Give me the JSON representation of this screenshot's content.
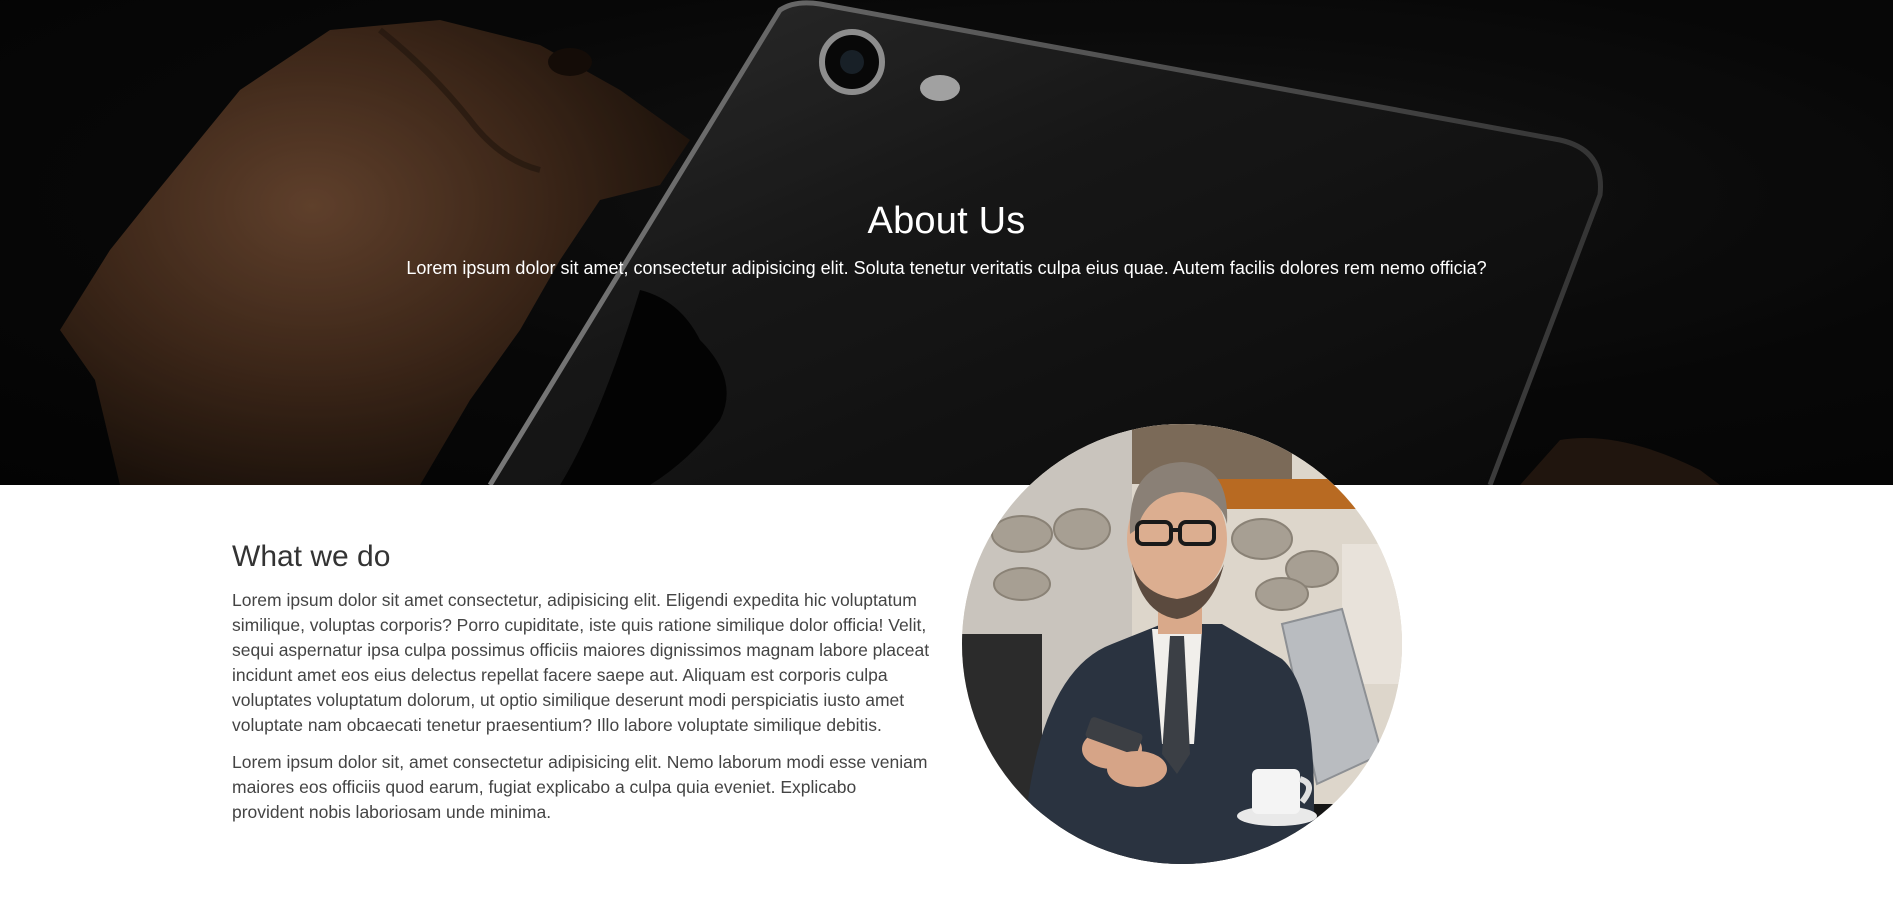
{
  "hero": {
    "title": "About Us",
    "subtitle": "Lorem ipsum dolor sit amet, consectetur adipisicing elit. Soluta tenetur veritatis culpa eius quae. Autem facilis dolores rem nemo officia?"
  },
  "about": {
    "heading": "What we do",
    "paragraphs": [
      "Lorem ipsum dolor sit amet consectetur, adipisicing elit. Eligendi expedita hic voluptatum similique, voluptas corporis? Porro cupiditate, iste quis ratione similique dolor officia! Velit, sequi aspernatur ipsa culpa possimus officiis maiores dignissimos magnam labore placeat incidunt amet eos eius delectus repellat facere saepe aut. Aliquam est corporis culpa voluptates voluptatum dolorum, ut optio similique deserunt modi perspiciatis iusto amet voluptate nam obcaecati tenetur praesentium? Illo labore voluptate similique debitis.",
      "Lorem ipsum dolor sit, amet consectetur adipisicing elit. Nemo laborum modi esse veniam maiores eos officiis quod earum, fugiat explicabo a culpa quia eveniet. Explicabo provident nobis laboriosam unde minima."
    ]
  },
  "colors": {
    "hero_background": "#0a0a0a",
    "hero_text": "#ffffff",
    "heading_text": "#333333",
    "body_text": "#444444"
  }
}
